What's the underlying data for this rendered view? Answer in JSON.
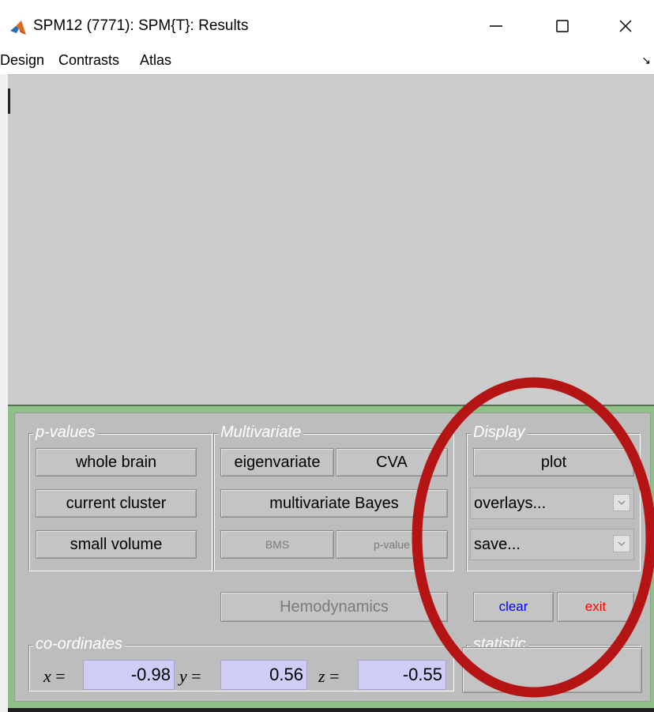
{
  "window": {
    "title": "SPM12 (7771): SPM{T}: Results",
    "controls": {
      "minimize": "minimize",
      "maximize": "maximize",
      "close": "close"
    }
  },
  "menubar": {
    "items": [
      "Design",
      "Contrasts",
      "Atlas"
    ],
    "toggle_glyph": "↘"
  },
  "panel": {
    "pvalues": {
      "title": "p-values",
      "buttons": [
        "whole brain",
        "current cluster",
        "small volume"
      ]
    },
    "multivariate": {
      "title": "Multivariate",
      "eigenvariate": "eigenvariate",
      "cva": "CVA",
      "bayes": "multivariate Bayes",
      "bms": "BMS",
      "pvalue": "p-value"
    },
    "display": {
      "title": "Display",
      "plot": "plot",
      "overlays": "overlays...",
      "save": "save..."
    },
    "hemodynamics": "Hemodynamics",
    "clear": "clear",
    "exit": "exit",
    "coordinates": {
      "title": "co-ordinates",
      "x_label": "x",
      "y_label": "y",
      "z_label": "z",
      "equals": "=",
      "x": "-0.98",
      "y": "0.56",
      "z": "-0.55"
    },
    "statistic": {
      "title": "statistic"
    }
  },
  "colors": {
    "panel_border": "#8fc08a",
    "panel_bg": "#bdbdbd",
    "figure_bg": "#cccccc",
    "clear_text": "#0000ff",
    "exit_text": "#ff0000",
    "coord_field_bg": "#cfcdf6",
    "annotation": "#b41414"
  },
  "annotation": {
    "shape": "ellipse",
    "color": "#b41414"
  }
}
